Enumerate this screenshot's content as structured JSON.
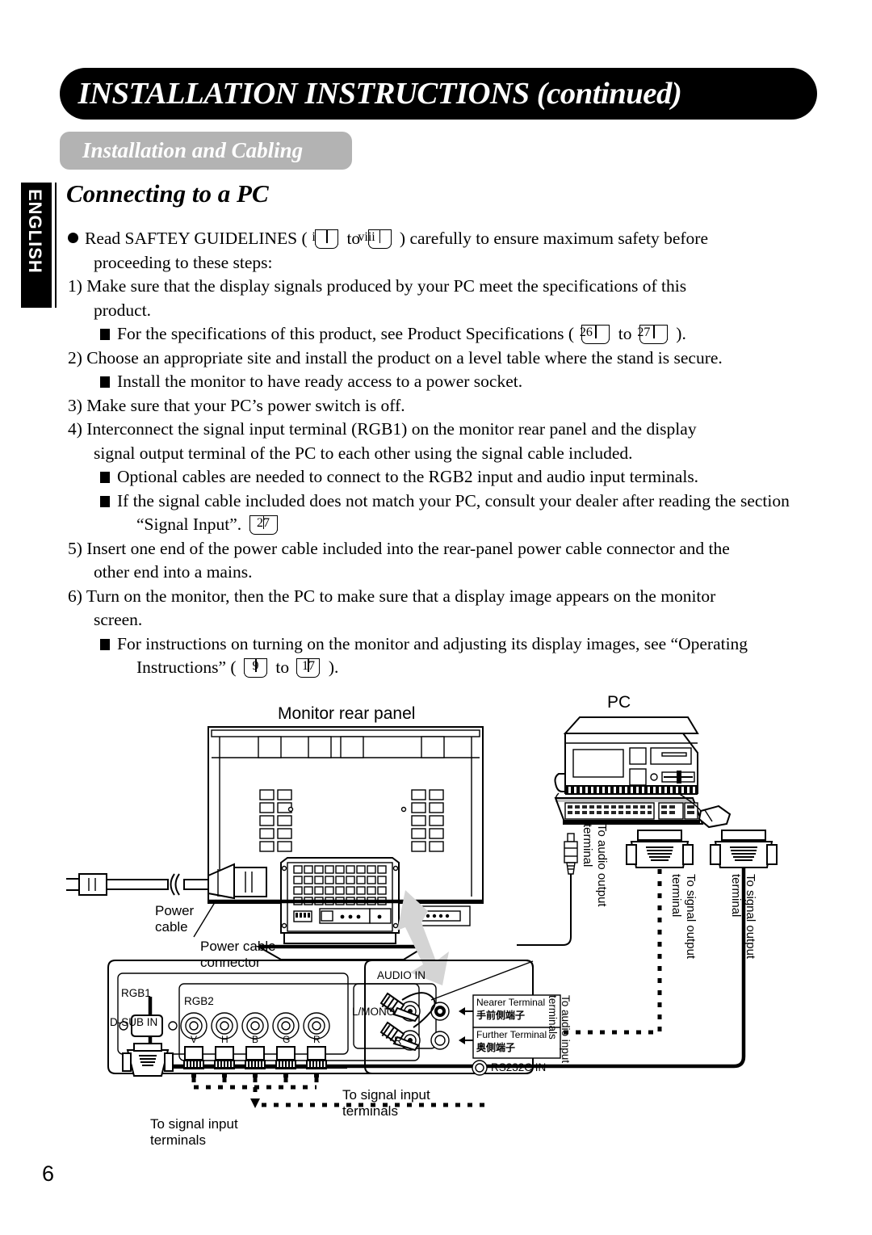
{
  "header": {
    "title": "INSTALLATION INSTRUCTIONS (continued)",
    "subtitle": "Installation and Cabling",
    "section_title": "Connecting to a PC",
    "lang_tab": "ENGLISH"
  },
  "body": {
    "intro_bullet": {
      "pre": "Read SAFTEY GUIDELINES (",
      "ref_from": "i",
      "mid": "to",
      "ref_to": "viii",
      "post": ") carefully to ensure maximum safety before",
      "line2": "proceeding to these steps:"
    },
    "steps": [
      {
        "num": "1)",
        "line1": "Make sure that the display signals produced by your PC meet the specifications of this",
        "line2": "product.",
        "subs": [
          {
            "pre": "For the specifications of this product, see Product Specifications (",
            "ref_from": "26",
            "mid": "to",
            "ref_to": "27",
            "post": ")."
          }
        ]
      },
      {
        "num": "2)",
        "line1": "Choose an appropriate site and install the product on a level table where the stand is secure.",
        "line2": "",
        "subs": [
          {
            "pre": "Install the monitor to have ready access to a power socket.",
            "ref_from": "",
            "mid": "",
            "ref_to": "",
            "post": ""
          }
        ]
      },
      {
        "num": "3)",
        "line1": "Make sure that your PC’s power switch is off.",
        "line2": "",
        "subs": []
      },
      {
        "num": "4)",
        "line1": "Interconnect the signal input terminal (RGB1) on the monitor rear panel and the display",
        "line2": "signal output terminal of the PC to each other using the signal cable included.",
        "subs": [
          {
            "pre": "Optional cables are needed to connect to the RGB2 input and audio input terminals.",
            "ref_from": "",
            "mid": "",
            "ref_to": "",
            "post": ""
          },
          {
            "pre": "If the signal cable included does not match your PC, consult your dealer after reading the section",
            "ref_from": "",
            "mid": "",
            "ref_to": "",
            "post": ""
          }
        ],
        "sub_cont": "“Signal Input”.",
        "sub_cont_ref": "27"
      },
      {
        "num": "5)",
        "line1": "Insert one end of the power cable included into the rear-panel power cable connector and the",
        "line2": "other end into a mains.",
        "subs": []
      },
      {
        "num": "6)",
        "line1": "Turn on the monitor, then the PC to make sure that a display image appears on the monitor",
        "line2": "screen.",
        "subs": [
          {
            "pre": "For instructions on turning on the monitor and adjusting its display images, see “Operating",
            "ref_from": "",
            "mid": "",
            "ref_to": "",
            "post": ""
          }
        ],
        "sub_cont": "Instructions” (",
        "sub_cont_ref_from": "9",
        "sub_cont_mid": "to",
        "sub_cont_ref_to": "17",
        "sub_cont_post": ")."
      }
    ]
  },
  "diagram": {
    "monitor_caption": "Monitor rear panel",
    "pc_caption": "PC",
    "power_cable": "Power\ncable",
    "power_cable_connector": "Power cable\nconnector",
    "audio_in": "AUDIO  IN",
    "rgb1": "RGB1",
    "rgb2": "RGB2",
    "dsub_in": "D-SUB  IN",
    "lmono": "L/MONO",
    "r_channel": "R",
    "bnc_labels": [
      "V",
      "H",
      "B",
      "G",
      "R"
    ],
    "nearer_terminal_en": "Nearer Terminal",
    "nearer_terminal_jp": "手前側端子",
    "further_terminal_en": "Further Terminal",
    "further_terminal_jp": "奥側端子",
    "rs232c": "RS232C  IN",
    "to_audio_output": "To audio output\nterminal",
    "to_signal_output_1": "To signal output\nterminal",
    "to_signal_output_2": "To signal output\nterminal",
    "to_audio_input": "To audio input\nterminals",
    "to_signal_input_1": "To signal input\nterminals",
    "to_signal_input_2": "To signal input\nterminals"
  },
  "footer": {
    "page_number": "6"
  },
  "colors": {
    "banner_black": "#000000",
    "subtitle_gray": "#b3b3b3",
    "arrow_gray": "#d4d4d4"
  }
}
